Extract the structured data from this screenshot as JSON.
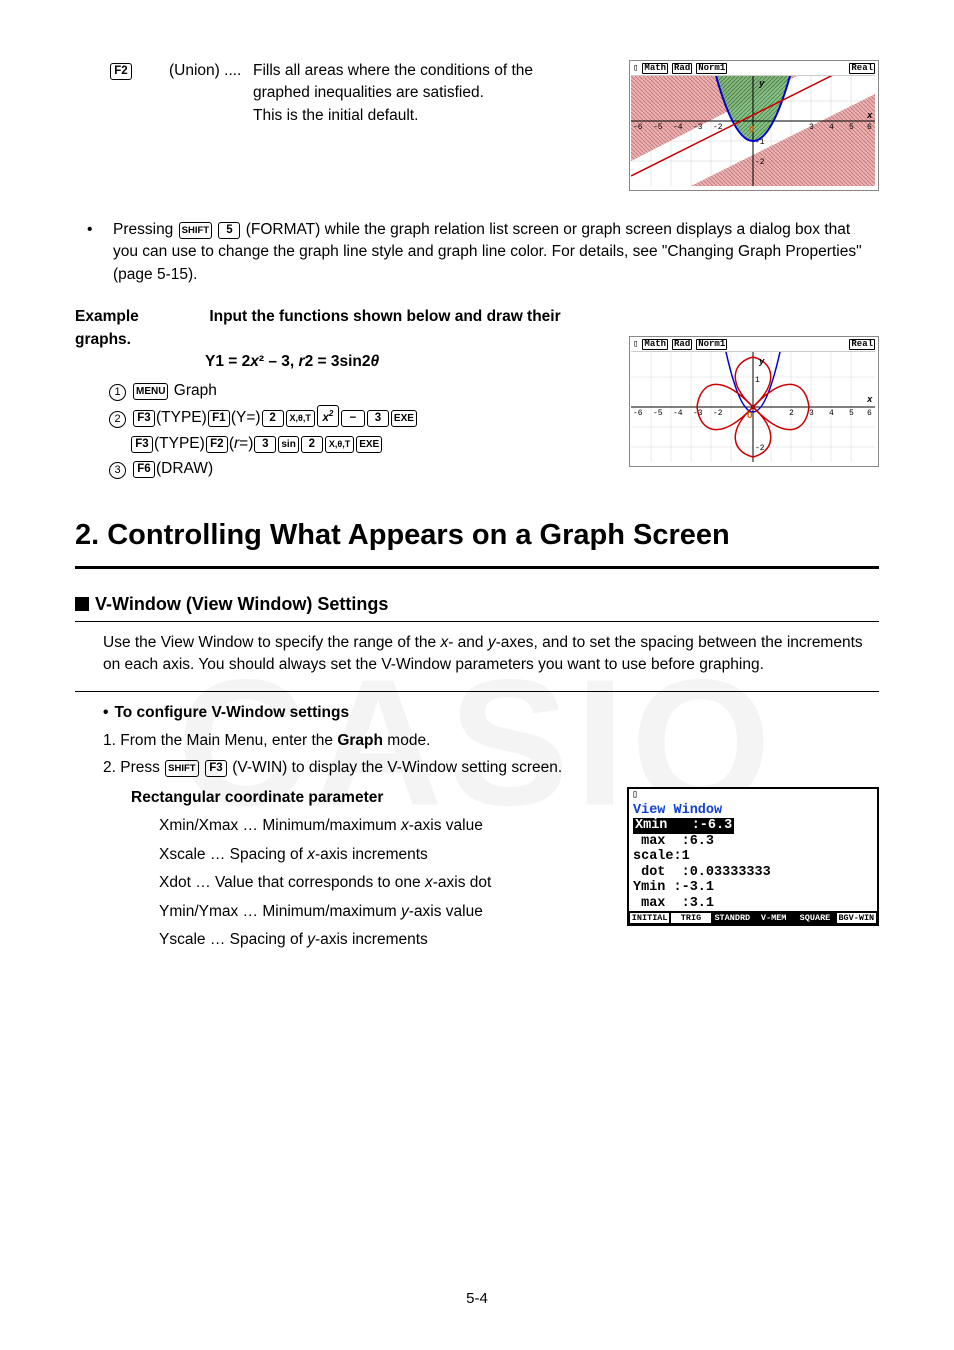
{
  "top": {
    "key_f2": "F2",
    "union_label": "(Union)",
    "dots": "....",
    "union_desc1": "Fills all areas where the conditions of the",
    "union_desc2": "graphed inequalities are satisfied.",
    "union_desc3": "This is the initial default.",
    "calc_topbar": [
      "Math",
      "Rad",
      "Norm1",
      "Real"
    ]
  },
  "format_note": {
    "prefix": "Pressing",
    "k_shift": "SHIFT",
    "k_5": "5",
    "format_lbl": "(FORMAT)",
    "text": "while the graph relation list screen or graph screen displays a dialog box that you can use to change the graph line style and graph line color. For details, see \"Changing Graph Properties\" (page 5-15)."
  },
  "example": {
    "label": "Example",
    "instruction": "Input the functions shown below and draw their graphs.",
    "funcs_a": "Y1 = 2",
    "funcs_b": "x",
    "funcs_c": "² – 3, ",
    "funcs_d": "r",
    "funcs_e": "2 = 3sin2",
    "funcs_theta": "θ",
    "steps": [
      {
        "n": "1",
        "parts": [
          {
            "type": "key",
            "v": "MENU"
          },
          {
            "type": "text",
            "v": " Graph"
          }
        ]
      },
      {
        "n": "2",
        "parts": [
          {
            "type": "key",
            "v": "F3"
          },
          {
            "type": "text",
            "v": "(TYPE)"
          },
          {
            "type": "key",
            "v": "F1"
          },
          {
            "type": "text",
            "v": "(Y=)"
          },
          {
            "type": "key",
            "v": "2"
          },
          {
            "type": "key",
            "v": "X,θ,T"
          },
          {
            "type": "key",
            "v": "x²"
          },
          {
            "type": "key",
            "v": "−"
          },
          {
            "type": "key",
            "v": "3"
          },
          {
            "type": "key",
            "v": "EXE"
          }
        ]
      },
      {
        "n": "",
        "parts": [
          {
            "type": "key",
            "v": "F3"
          },
          {
            "type": "text",
            "v": "(TYPE)"
          },
          {
            "type": "key",
            "v": "F2"
          },
          {
            "type": "text",
            "v": "("
          },
          {
            "type": "ital",
            "v": "r"
          },
          {
            "type": "text",
            "v": "=)"
          },
          {
            "type": "key",
            "v": "3"
          },
          {
            "type": "key",
            "v": "sin"
          },
          {
            "type": "key",
            "v": "2"
          },
          {
            "type": "key",
            "v": "X,θ,T"
          },
          {
            "type": "key",
            "v": "EXE"
          }
        ]
      },
      {
        "n": "3",
        "parts": [
          {
            "type": "key",
            "v": "F6"
          },
          {
            "type": "text",
            "v": "(DRAW)"
          }
        ]
      }
    ]
  },
  "section2": {
    "title": "2. Controlling What Appears on a Graph Screen",
    "vwin_heading": "V-Window (View Window) Settings",
    "vwin_desc_a": "Use the View Window to specify the range of the ",
    "vwin_desc_b": "x",
    "vwin_desc_c": "- and ",
    "vwin_desc_d": "y",
    "vwin_desc_e": "-axes, and to set the spacing between the increments on each axis. You should always set the V-Window parameters you want to use before graphing.",
    "configure_heading": "To configure V-Window settings",
    "step1_a": "1. From the Main Menu, enter the ",
    "step1_b": "Graph",
    "step1_c": " mode.",
    "step2_a": "2. Press ",
    "step2_k1": "SHIFT",
    "step2_k2": "F3",
    "step2_b": "(V-WIN) to display the V-Window setting screen.",
    "rect_heading": "Rectangular coordinate parameter",
    "params": [
      {
        "a": "Xmin/Xmax … Minimum/maximum ",
        "i": "x",
        "b": "-axis value"
      },
      {
        "a": "Xscale … Spacing of ",
        "i": "x",
        "b": "-axis increments"
      },
      {
        "a": "Xdot … Value that corresponds to one ",
        "i": "x",
        "b": "-axis dot"
      },
      {
        "a": "Ymin/Ymax … Minimum/maximum ",
        "i": "y",
        "b": "-axis value"
      },
      {
        "a": "Yscale … Spacing of ",
        "i": "y",
        "b": "-axis increments"
      }
    ]
  },
  "vwindow_screen": {
    "title": "View Window",
    "rows": [
      {
        "lbl": "Xmin",
        "val": ":-6.3",
        "hl": true
      },
      {
        "lbl": "max",
        "val": ":6.3"
      },
      {
        "lbl": "scale",
        "val": ":1"
      },
      {
        "lbl": "dot",
        "val": ":0.03333333"
      },
      {
        "lbl": "Ymin",
        "val": ":-3.1"
      },
      {
        "lbl": "max",
        "val": ":3.1"
      }
    ],
    "fkeys": [
      "INITIAL",
      "TRIG",
      "STANDRD",
      "V-MEM",
      "SQUARE",
      "BGV-WIN"
    ]
  },
  "pagefoot": "5-4",
  "watermark": "CASIO"
}
